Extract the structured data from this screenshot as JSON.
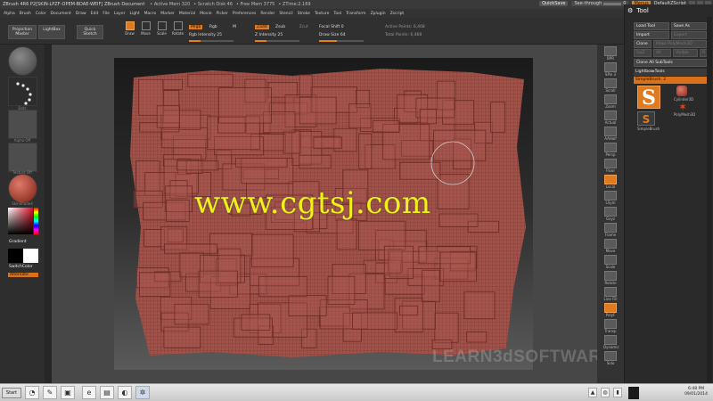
{
  "titlebar": {
    "title": "ZBrush 4R6 P2[SKIN-LPZF-OPEM-BDAE-WEIF]  ZBrush Document",
    "stats": [
      "• Active Mem 320",
      "• Scratch Disk 46",
      "• Free Mem 3775",
      "• ZTime:2.169"
    ],
    "quicksave": "QuickSave",
    "seethrough": "See-through",
    "seethrough_value": "0",
    "seethrough_fraction": 0.0,
    "menus": "Menus",
    "script": "DefaultZScript"
  },
  "menubar": [
    "Alpha",
    "Brush",
    "Color",
    "Document",
    "Draw",
    "Edit",
    "File",
    "Layer",
    "Light",
    "Macro",
    "Marker",
    "Material",
    "Movie",
    "Picker",
    "Preferences",
    "Render",
    "Stencil",
    "Stroke",
    "Texture",
    "Tool",
    "Transform",
    "Zplugin",
    "Zscript"
  ],
  "shelf": {
    "projection_master": "Projection Master",
    "lightbox": "LightBox",
    "quick_sketch": "Quick Sketch",
    "tools": [
      "Draw",
      "Move",
      "Scale",
      "Rotate"
    ],
    "mrgb": "Mrgb",
    "rgb": "Rgb",
    "m": "M",
    "rgb_intensity": "Rgb Intensity 25",
    "zadd": "Zadd",
    "zsub": "Zsub",
    "zcut": "Zcut",
    "z_intensity": "Z Intensity 25",
    "focal_shift": "Focal Shift 0",
    "draw_size": "Draw Size 64",
    "active_points": "Active Points: 6,468",
    "total_points": "Total Points: 6,468",
    "rgb_intensity_fraction": 0.25,
    "z_intensity_fraction": 0.25
  },
  "lefttray": {
    "labels": [
      "Standard",
      "Dots",
      "Alpha Off",
      "Texture Off",
      "SkinShade4"
    ],
    "gradient": "Gradient",
    "switch_color": "SwitchColor",
    "alternate": "Alternate"
  },
  "canvas": {
    "watermark": "www.cgtsj.com",
    "learn": "LEARN3dSOFTWARE.com"
  },
  "righttray": [
    "BPR",
    "SPix 3",
    "Scroll",
    "Zoom",
    "Actual",
    "AAHalf",
    "Persp",
    "Floor",
    "Local",
    "LSym",
    "Gxyz",
    "Frame",
    "Move",
    "Scale",
    "Rotate",
    "Line Fill",
    "PolyF",
    "Transp",
    "Dynamic",
    "Solo"
  ],
  "toolpalette": {
    "title": "Tool",
    "load_tool": "Load Tool",
    "save_as": "Save As",
    "import": "Import",
    "export": "Export",
    "clone": "Clone",
    "make_polymesh": "Make PolyMesh3D",
    "goz": "GoZ",
    "all": "All",
    "visible": "Visible",
    "r": "R",
    "clone_subtools": "Clone All SubTools",
    "lightbox_tools": "Lightbox▸Tools",
    "current_tool": "SimpleBrush. 2",
    "thumbs": [
      "Cylinder3D",
      "PolyMesh3D",
      "SimpleBrush"
    ]
  },
  "taskbar": {
    "start": "Start",
    "time": "6:48 PM",
    "date": "09/01/2014"
  },
  "colors": {
    "accent": "#e07a1e",
    "mesh": "#a0524a",
    "watermark": "#f2ef18"
  }
}
